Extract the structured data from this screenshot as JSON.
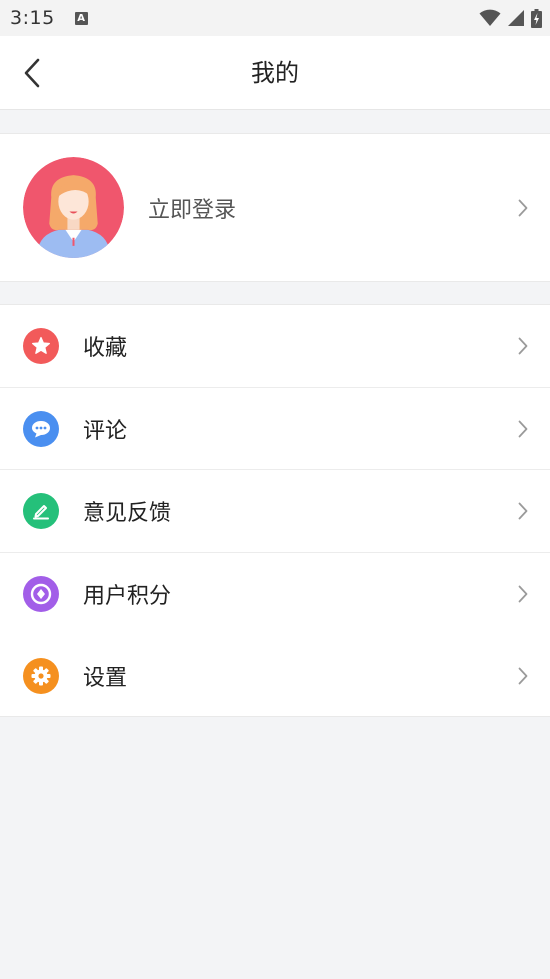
{
  "status": {
    "time": "3:15",
    "notif": "A"
  },
  "nav": {
    "title": "我的"
  },
  "profile": {
    "login_label": "立即登录"
  },
  "menu": [
    {
      "label": "收藏",
      "icon": "star-icon",
      "color": "#f25a5a"
    },
    {
      "label": "评论",
      "icon": "chat-icon",
      "color": "#4a8ff0"
    },
    {
      "label": "意见反馈",
      "icon": "edit-icon",
      "color": "#25c07a"
    },
    {
      "label": "用户积分",
      "icon": "diamond-icon",
      "color": "#a25ee8"
    },
    {
      "label": "设置",
      "icon": "gear-icon",
      "color": "#f5901f"
    }
  ]
}
